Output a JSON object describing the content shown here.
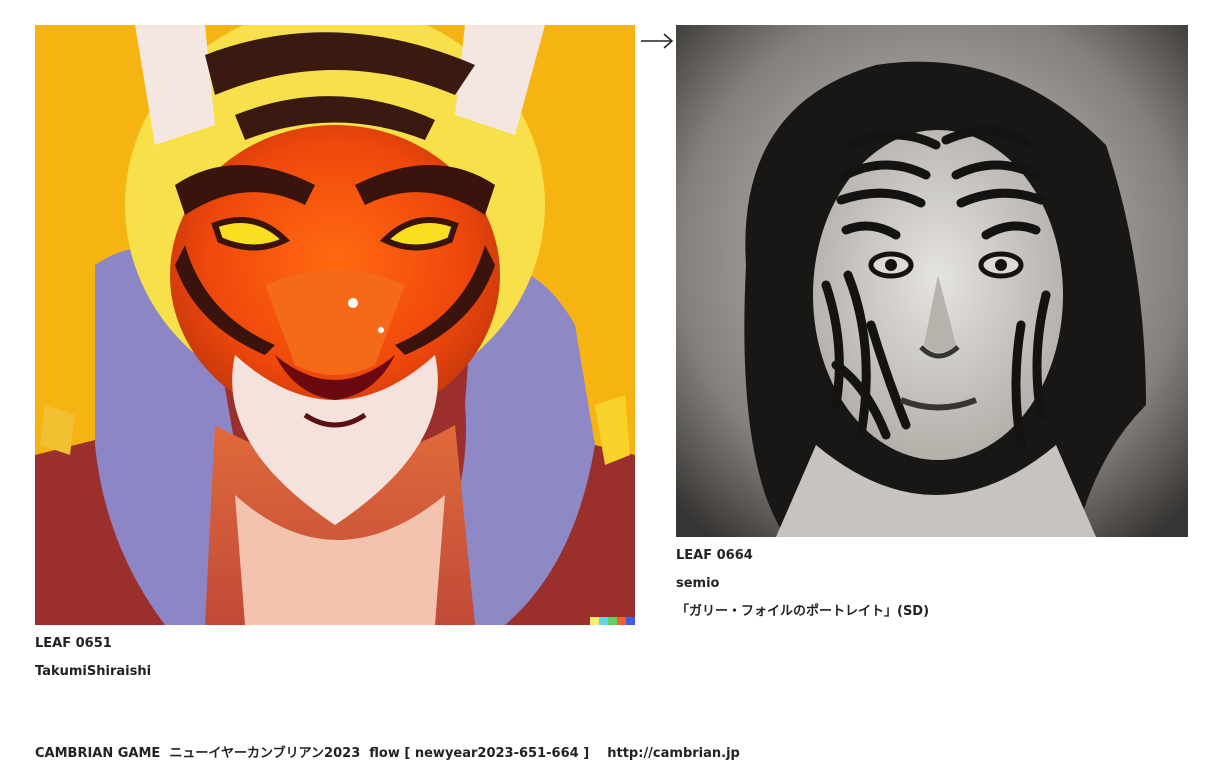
{
  "left_leaf": {
    "image_subject": "tiger-portrait-painting",
    "leaf_id": "LEAF 0651",
    "author": "TakumiShiraishi"
  },
  "arrow": {
    "glyph": "→"
  },
  "right_leaf": {
    "image_subject": "tiger-striped-face-portrait-photo",
    "leaf_id": "LEAF 0664",
    "author": "semio",
    "title": "「ガリー・フォイルのポートレイト」(SD)"
  },
  "footer": {
    "game_text": "CAMBRIAN GAME  ニューイヤーカンブリアン2023  flow [ newyear2023-651-664 ]",
    "url": "http://cambrian.jp"
  },
  "colors": {
    "text": "#222222",
    "background": "#ffffff",
    "tiger_bg": "#f6b412",
    "tiger_orange": "#f05a12"
  }
}
